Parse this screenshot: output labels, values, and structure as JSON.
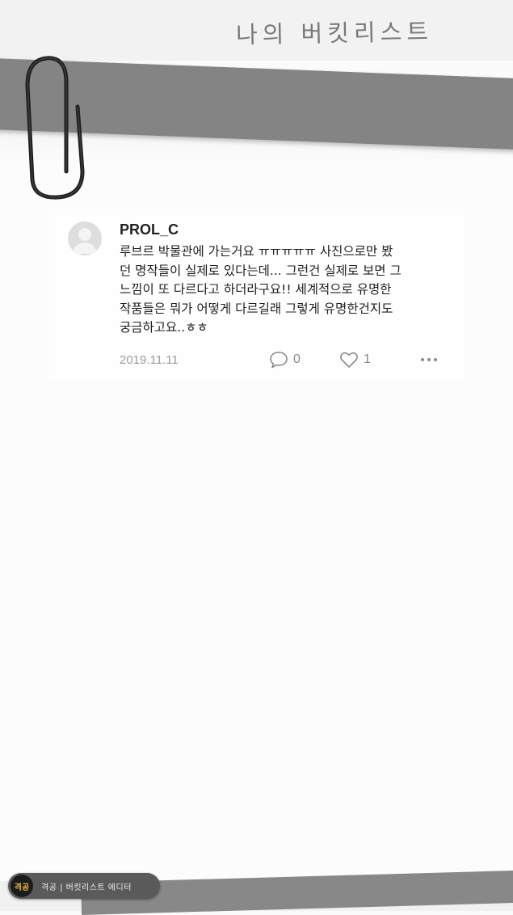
{
  "header": {
    "title": "나의 버킷리스트"
  },
  "post": {
    "username": "PROL_C",
    "lines": [
      "루브르 박물관에 가는거요 ㅠㅠㅠㅠㅠ 사진으로만 봤",
      "던 명작들이 실제로 있다는데... 그런건 실제로 보면 그",
      "느낌이 또 다르다고 하더라구요!! 세계적으로 유명한",
      "작품들은 뭐가 어떻게 다르길래 그렇게 유명한건지도",
      "궁금하고요..ㅎㅎ"
    ],
    "date": "2019.11.11",
    "comment_count": "0",
    "like_count": "1"
  },
  "footer": {
    "badge_logo": "격공",
    "badge_text": "격공 | 버킷리스트 에디터"
  },
  "icons": {
    "comment": "comment-bubble-icon",
    "like": "heart-icon",
    "more": "more-dots-icon",
    "clip": "paperclip-icon"
  },
  "colors": {
    "tape": "#848484",
    "paper": "#fbfbfb",
    "text": "#1e1e1e",
    "meta": "#9a9a9a"
  }
}
